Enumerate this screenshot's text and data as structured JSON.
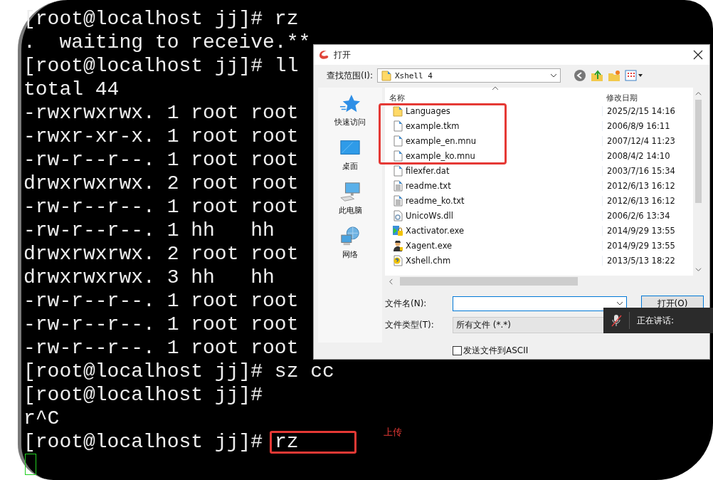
{
  "terminal": {
    "lines": [
      "[root@localhost jj]# rz",
      ".  waiting to receive.**",
      "[root@localhost jj]# ll",
      "total 44",
      "-rwxrwxrwx. 1 root root",
      "-rwxr-xr-x. 1 root root",
      "-rw-r--r--. 1 root root",
      "drwxrwxrwx. 2 root root",
      "-rw-r--r--. 1 root root",
      "-rw-r--r--. 1 hh   hh",
      "drwxrwxrwx. 2 root root",
      "drwxrwxrwx. 3 hh   hh",
      "-rw-r--r--. 1 root root",
      "-rw-r--r--. 1 root root",
      "-rw-r--r--. 1 root root",
      "[root@localhost jj]# sz cc",
      "[root@localhost jj]#",
      "r^C"
    ],
    "last_prompt": "[root@localhost jj]#",
    "last_command": "rz",
    "annotation": "上传"
  },
  "dialog": {
    "title": "打开",
    "look_in_label": "查找范围(I):",
    "look_in_value": "Xshell 4",
    "places": [
      {
        "label": "快速访问",
        "kind": "star"
      },
      {
        "label": "桌面",
        "kind": "desktop"
      },
      {
        "label": "此电脑",
        "kind": "computer"
      },
      {
        "label": "网络",
        "kind": "network"
      }
    ],
    "columns": [
      "名称",
      "修改日期"
    ],
    "files": [
      {
        "name": "Languages",
        "date": "2025/2/15 14:16",
        "kind": "folder"
      },
      {
        "name": "example.tkm",
        "date": "2006/8/9 16:11",
        "kind": "file"
      },
      {
        "name": "example_en.mnu",
        "date": "2007/12/4 11:23",
        "kind": "file"
      },
      {
        "name": "example_ko.mnu",
        "date": "2008/4/2 14:10",
        "kind": "file"
      },
      {
        "name": "filexfer.dat",
        "date": "2003/7/16 15:34",
        "kind": "file"
      },
      {
        "name": "readme.txt",
        "date": "2012/6/13 16:12",
        "kind": "text"
      },
      {
        "name": "readme_ko.txt",
        "date": "2012/6/13 16:12",
        "kind": "text"
      },
      {
        "name": "UnicoWs.dll",
        "date": "2006/2/6 13:34",
        "kind": "dll"
      },
      {
        "name": "Xactivator.exe",
        "date": "2014/9/29 13:55",
        "kind": "app"
      },
      {
        "name": "Xagent.exe",
        "date": "2014/9/29 13:55",
        "kind": "agent"
      },
      {
        "name": "Xshell.chm",
        "date": "2013/5/13 18:22",
        "kind": "help"
      }
    ],
    "filename_label": "文件名(N):",
    "open_button": "打开(O)",
    "filetype_label": "文件类型(T):",
    "filetype_value": "所有文件 (*.*)",
    "ascii_checkbox": {
      "label": "发送文件到ASCII",
      "checked": false
    }
  },
  "toast": {
    "text": "正在讲话:"
  }
}
